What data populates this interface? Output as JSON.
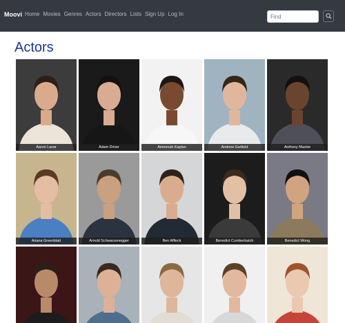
{
  "navbar": {
    "brand": "Moovi",
    "links": [
      "Home",
      "Movies",
      "Genres",
      "Actors",
      "Directors",
      "Lists",
      "Sign Up",
      "Log In"
    ],
    "search_placeholder": "Find",
    "search_icon": "search-icon"
  },
  "page": {
    "title": "Actors"
  },
  "actors": [
    {
      "name": "Aaron Lazar",
      "bg": "#3c3c3c",
      "skin": "#d9ab8c",
      "hair": "#2e2018",
      "shirt": "#ece4d8"
    },
    {
      "name": "Adam Driver",
      "bg": "#1a1a1a",
      "skin": "#d8ac92",
      "hair": "#141010",
      "shirt": "#161616"
    },
    {
      "name": "Ameenah Kaplan",
      "bg": "#f2f2f2",
      "skin": "#7a4a30",
      "hair": "#1e1612",
      "shirt": "#f7f7f7"
    },
    {
      "name": "Andrew Garfield",
      "bg": "#9fb3c1",
      "skin": "#e0b79c",
      "hair": "#35261a",
      "shirt": "#e8eaec"
    },
    {
      "name": "Anthony Mackie",
      "bg": "#2a2a2a",
      "skin": "#6b4430",
      "hair": "#141010",
      "shirt": "#4f4f5a"
    },
    {
      "name": "Ariana Greenblatt",
      "bg": "#c7b58e",
      "skin": "#e4bda3",
      "hair": "#5a3a22",
      "shirt": "#4a7fc1"
    },
    {
      "name": "Arnold Schwarzenegger",
      "bg": "#9a9a9a",
      "skin": "#caa07e",
      "hair": "#4a3a2a",
      "shirt": "#2b3340"
    },
    {
      "name": "Ben Affleck",
      "bg": "#d4d6d8",
      "skin": "#d9ac8e",
      "hair": "#2e2218",
      "shirt": "#222a33"
    },
    {
      "name": "Benedict Cumberbatch",
      "bg": "#1c1c1c",
      "skin": "#e2c0a4",
      "hair": "#3b2a1d",
      "shirt": "#3a3a3a"
    },
    {
      "name": "Benedict Wong",
      "bg": "#7a7a86",
      "skin": "#d1a47f",
      "hair": "#141010",
      "shirt": "#8c7a5c"
    },
    {
      "name": "",
      "bg": "#3a1616",
      "skin": "#b98a6a",
      "hair": "#2a201a",
      "shirt": "#1c1c1c"
    },
    {
      "name": "",
      "bg": "#a8b2b8",
      "skin": "#deb196",
      "hair": "#3a2a1e",
      "shirt": "#4f6d8c"
    },
    {
      "name": "",
      "bg": "#e6e6e6",
      "skin": "#dfb69a",
      "hair": "#8a6a42",
      "shirt": "#e2dcd2"
    },
    {
      "name": "",
      "bg": "#f0f0f0",
      "skin": "#e2b99e",
      "hair": "#5a4128",
      "shirt": "#d8d8d8"
    },
    {
      "name": "",
      "bg": "#efe6d8",
      "skin": "#ebc8b0",
      "hair": "#a0522d",
      "shirt": "#c8443a"
    }
  ]
}
